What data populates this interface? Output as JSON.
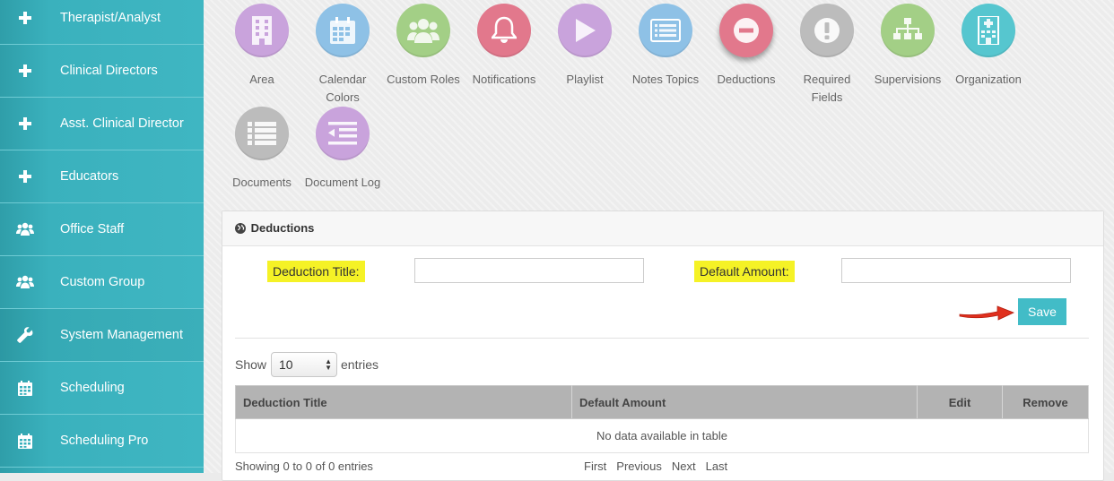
{
  "sidebar": {
    "items": [
      {
        "label": "Therapist/Analyst",
        "icon": "plus-icon"
      },
      {
        "label": "Clinical Directors",
        "icon": "plus-icon"
      },
      {
        "label": "Asst. Clinical Director",
        "icon": "plus-icon"
      },
      {
        "label": "Educators",
        "icon": "plus-icon"
      },
      {
        "label": "Office Staff",
        "icon": "users-icon"
      },
      {
        "label": "Custom Group",
        "icon": "users-icon"
      },
      {
        "label": "System Management",
        "icon": "wrench-icon"
      },
      {
        "label": "Scheduling",
        "icon": "calendar-icon"
      },
      {
        "label": "Scheduling Pro",
        "icon": "calendar-icon"
      }
    ]
  },
  "tiles": [
    {
      "label": "Area",
      "icon": "building-icon",
      "color": "#c9a3dc"
    },
    {
      "label": "Calendar Colors",
      "icon": "calendar-icon",
      "color": "#8ec1e6"
    },
    {
      "label": "Custom Roles",
      "icon": "users-icon",
      "color": "#a3cf86"
    },
    {
      "label": "Notifications",
      "icon": "bell-icon",
      "color": "#e2788c"
    },
    {
      "label": "Playlist",
      "icon": "play-icon",
      "color": "#c9a3dc"
    },
    {
      "label": "Notes Topics",
      "icon": "list-icon",
      "color": "#8ec1e6"
    },
    {
      "label": "Deductions",
      "icon": "minus-circle-icon",
      "color": "#e2788c"
    },
    {
      "label": "Required Fields",
      "icon": "exclamation-icon",
      "color": "#bcbcbc"
    },
    {
      "label": "Supervisions",
      "icon": "sitemap-icon",
      "color": "#a3cf86"
    },
    {
      "label": "Organization",
      "icon": "hospital-icon",
      "color": "#56c6cf"
    },
    {
      "label": "Documents",
      "icon": "list-icon",
      "color": "#bcbcbc"
    },
    {
      "label": "Document Log",
      "icon": "indent-icon",
      "color": "#c9a3dc"
    }
  ],
  "panel": {
    "title": "Deductions",
    "form": {
      "title_label": "Deduction Title:",
      "title_value": "",
      "amount_label": "Default Amount:",
      "amount_value": "",
      "save_label": "Save"
    },
    "length": {
      "show": "Show",
      "value": "10",
      "entries": "entries"
    },
    "table": {
      "columns": [
        "Deduction Title",
        "Default Amount",
        "Edit",
        "Remove"
      ],
      "empty": "No data available in table"
    },
    "info": "Showing 0 to 0 of 0 entries",
    "pagination": [
      "First",
      "Previous",
      "Next",
      "Last"
    ]
  }
}
